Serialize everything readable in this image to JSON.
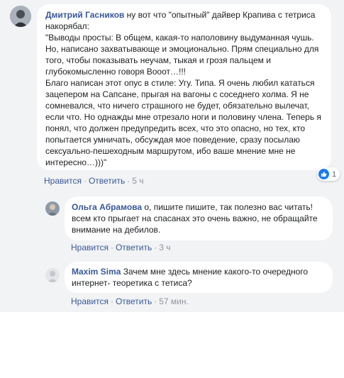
{
  "comments": [
    {
      "author": "Дмитрий Гасников",
      "text": " ну вот что \"опытный\" дайвер Крапива с тетриса накорябал:\n\"Выводы просты: В общем, какая-то наполовину выдуманная чушь. Но, написано захватывающе и эмоционально. Прям специально для того, чтобы показывать неучам, тыкая и грозя пальцем и глубокомысленно говоря Вооот…!!!\nБлаго написан этот опус в стиле: Угу. Типа. Я очень любил кататься зацепером на Сапсане, прыгая на вагоны с соседнего холма. Я не сомневался, что ничего страшного не будет, обязательно вылечат, если что. Но однажды мне отрезало ноги и половину члена. Теперь я понял, что должен предупредить всех, что это опасно, но тех, кто попытается умничать, обсуждая мое поведение, сразу посылаю сексуально-пешеходным маршрутом, ибо ваше мнение мне не интересно…)))\"",
      "like_label": "Нравится",
      "reply_label": "Ответить",
      "time": "5 ч",
      "reaction_count": "1",
      "separator": "·"
    },
    {
      "author": "Ольга Абрамова",
      "text": " о, пишите пишите, так полезно вас читать! всем кто прыгает на спасанах это очень важно, не обращайте внимание на дебилов.",
      "like_label": "Нравится",
      "reply_label": "Ответить",
      "time": "3 ч",
      "separator": "·"
    },
    {
      "author": "Maxim Sima",
      "text": " Зачем мне здесь мнение какого-то очередного интернет- теоретика с тетиса?",
      "like_label": "Нравится",
      "reply_label": "Ответить",
      "time": "57 мин.",
      "separator": "·"
    }
  ]
}
